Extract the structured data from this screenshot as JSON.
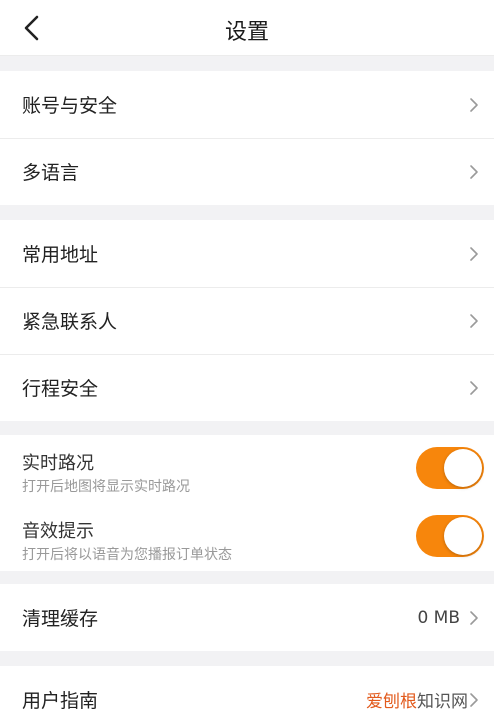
{
  "header": {
    "title": "设置",
    "back_icon": "chevron-left-icon"
  },
  "group1": {
    "items": [
      {
        "label": "账号与安全"
      },
      {
        "label": "多语言"
      }
    ]
  },
  "group2": {
    "items": [
      {
        "label": "常用地址"
      },
      {
        "label": "紧急联系人"
      },
      {
        "label": "行程安全"
      }
    ]
  },
  "toggles": [
    {
      "label": "实时路况",
      "desc": "打开后地图将显示实时路况",
      "on": true
    },
    {
      "label": "音效提示",
      "desc": "打开后将以语音为您播报订单状态",
      "on": true
    }
  ],
  "cache": {
    "label": "清理缓存",
    "value": "0 MB"
  },
  "guide": {
    "label": "用户指南"
  },
  "watermark": {
    "part1": "爱刨根",
    "part2": "知识网"
  },
  "colors": {
    "accent": "#f7860c",
    "background": "#f2f2f4"
  }
}
